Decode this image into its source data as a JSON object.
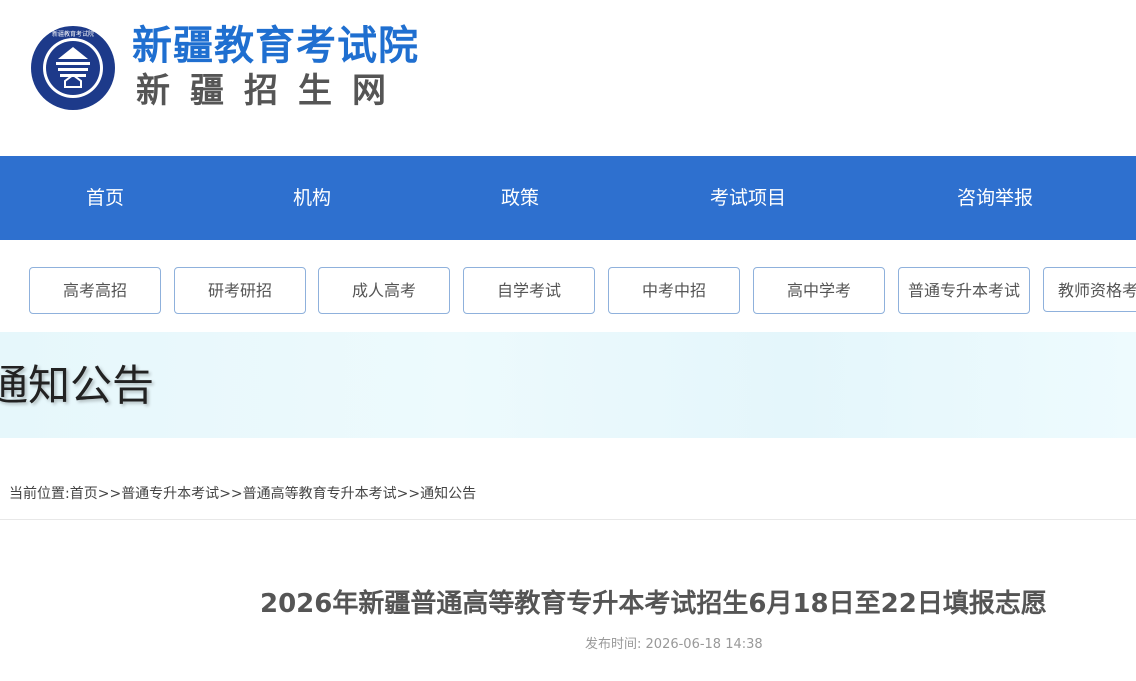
{
  "header": {
    "site_title": "新疆教育考试院",
    "site_subtitle": "新疆招生网",
    "logo_ring_text": "新疆教育考试院"
  },
  "nav": {
    "items": [
      "首页",
      "机构",
      "政策",
      "考试项目",
      "咨询举报"
    ]
  },
  "categories": {
    "items": [
      "高考高招",
      "研考研招",
      "成人高考",
      "自学考试",
      "中考中招",
      "高中学考",
      "普通专升本考试",
      "教师资格考"
    ]
  },
  "banner": {
    "title": "通知公告"
  },
  "breadcrumb": {
    "prefix": "当前位置:",
    "items": [
      "首页",
      "普通专升本考试",
      "普通高等教育专升本考试",
      "通知公告"
    ],
    "separator": ">>"
  },
  "article": {
    "title": "2026年新疆普通高等教育专升本考试招生6月18日至22日填报志愿",
    "publish_label": "发布时间:",
    "publish_time": "2026-06-18 14:38"
  },
  "colors": {
    "brand_blue": "#1f6fd0",
    "nav_bg": "#2e70cf",
    "emblem_navy": "#1d3a8a",
    "button_border": "#8fb1dc",
    "banner_bg": "#e6f7fb"
  },
  "icons": {
    "logo": "emblem-icon"
  }
}
